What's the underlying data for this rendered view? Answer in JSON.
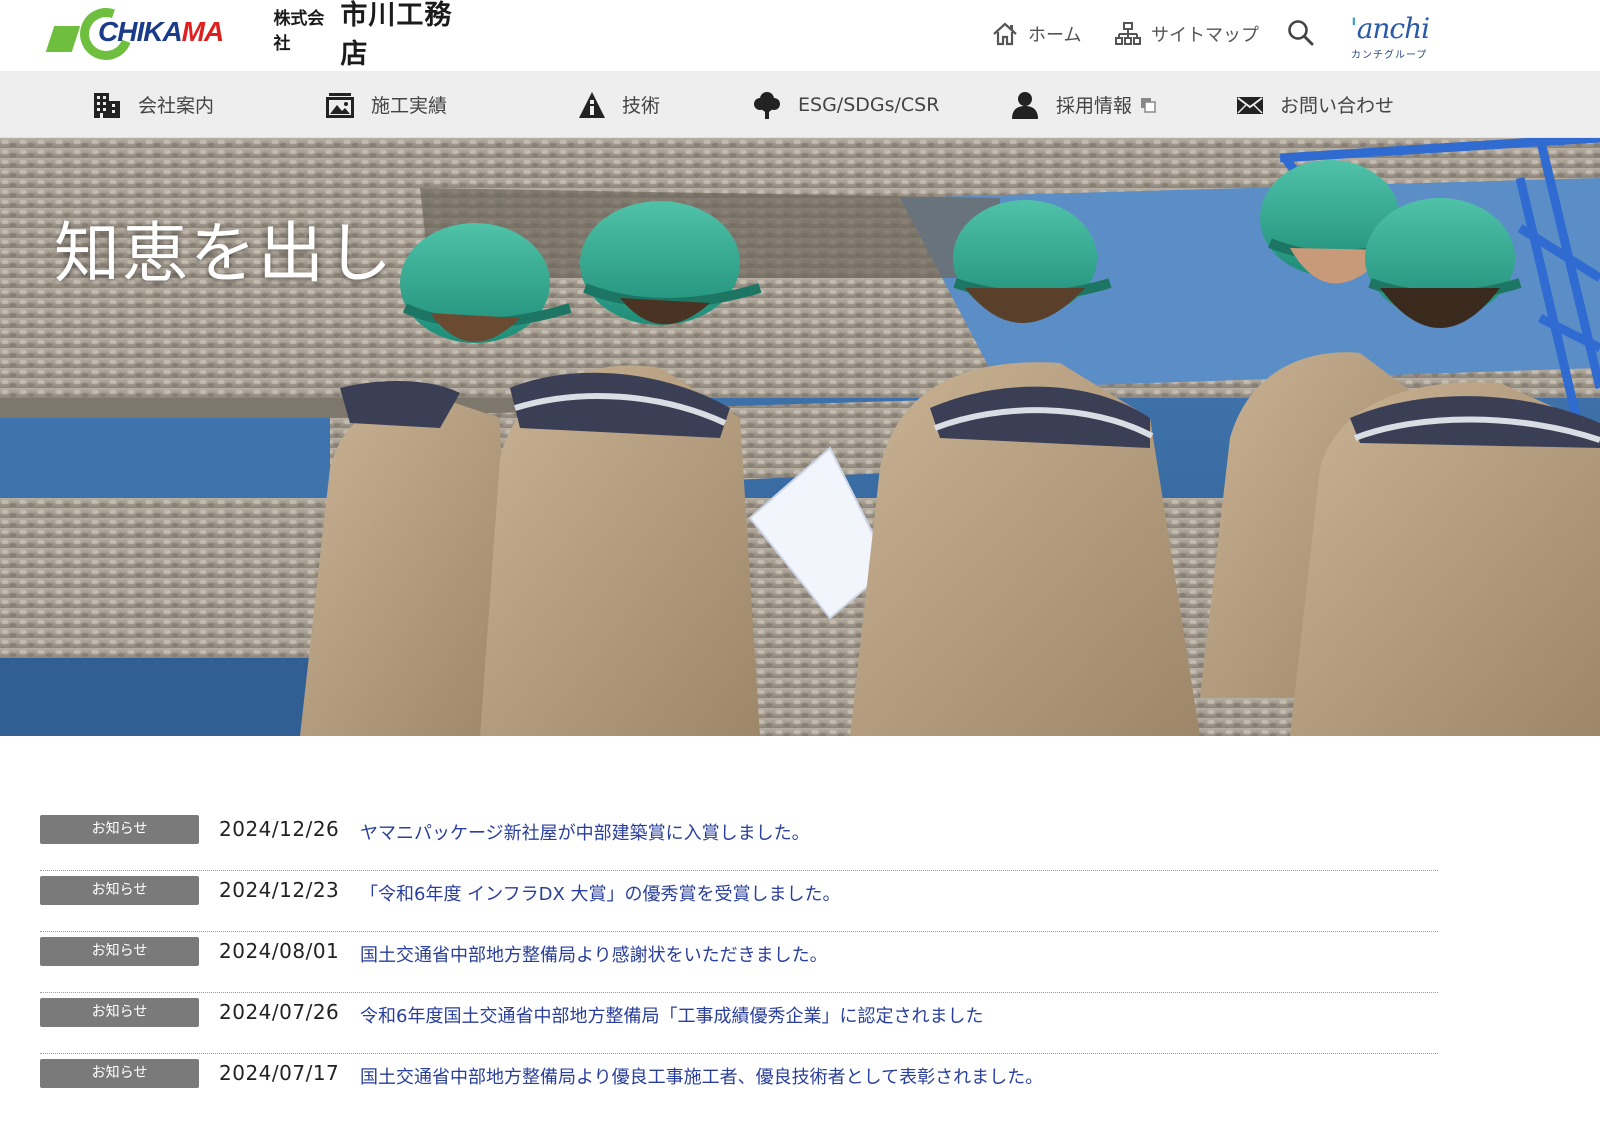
{
  "header": {
    "logo": {
      "mark_text_left": "CHIKA",
      "mark_text_right": "MA",
      "company_prefix": "株式会社",
      "company_name": "市川工務店"
    },
    "util": {
      "home_label": "ホーム",
      "sitemap_label": "サイトマップ"
    },
    "group_logo": {
      "word_tick": "'",
      "word": "anchi",
      "sub": "カンチグループ"
    }
  },
  "nav": {
    "items": [
      {
        "label": "会社案内",
        "icon": "building-icon"
      },
      {
        "label": "施工実績",
        "icon": "image-icon"
      },
      {
        "label": "技術",
        "icon": "info-icon"
      },
      {
        "label": "ESG/SDGs/CSR",
        "icon": "tree-icon"
      },
      {
        "label": "採用情報",
        "icon": "person-icon"
      },
      {
        "label": "お問い合わせ",
        "icon": "mail-icon"
      }
    ]
  },
  "hero": {
    "copy": "知恵を出し"
  },
  "news": {
    "badge_label": "お知らせ",
    "items": [
      {
        "date": "2024/12/26",
        "title": "ヤマニパッケージ新社屋が中部建築賞に入賞しました。"
      },
      {
        "date": "2024/12/23",
        "title": "「令和6年度 インフラDX 大賞」の優秀賞を受賞しました。"
      },
      {
        "date": "2024/08/01",
        "title": "国土交通省中部地方整備局より感謝状をいただきました。"
      },
      {
        "date": "2024/07/26",
        "title": "令和6年度国土交通省中部地方整備局「工事成績優秀企業」に認定されました"
      },
      {
        "date": "2024/07/17",
        "title": "国土交通省中部地方整備局より優良工事施工者、優良技術者として表彰されました。"
      }
    ]
  },
  "colors": {
    "accent_green": "#6fbf3f",
    "logo_blue": "#1a3a8a",
    "link_blue": "#2a3f9c",
    "badge_gray": "#7a7a7a",
    "nav_bg": "#eeeeee"
  }
}
